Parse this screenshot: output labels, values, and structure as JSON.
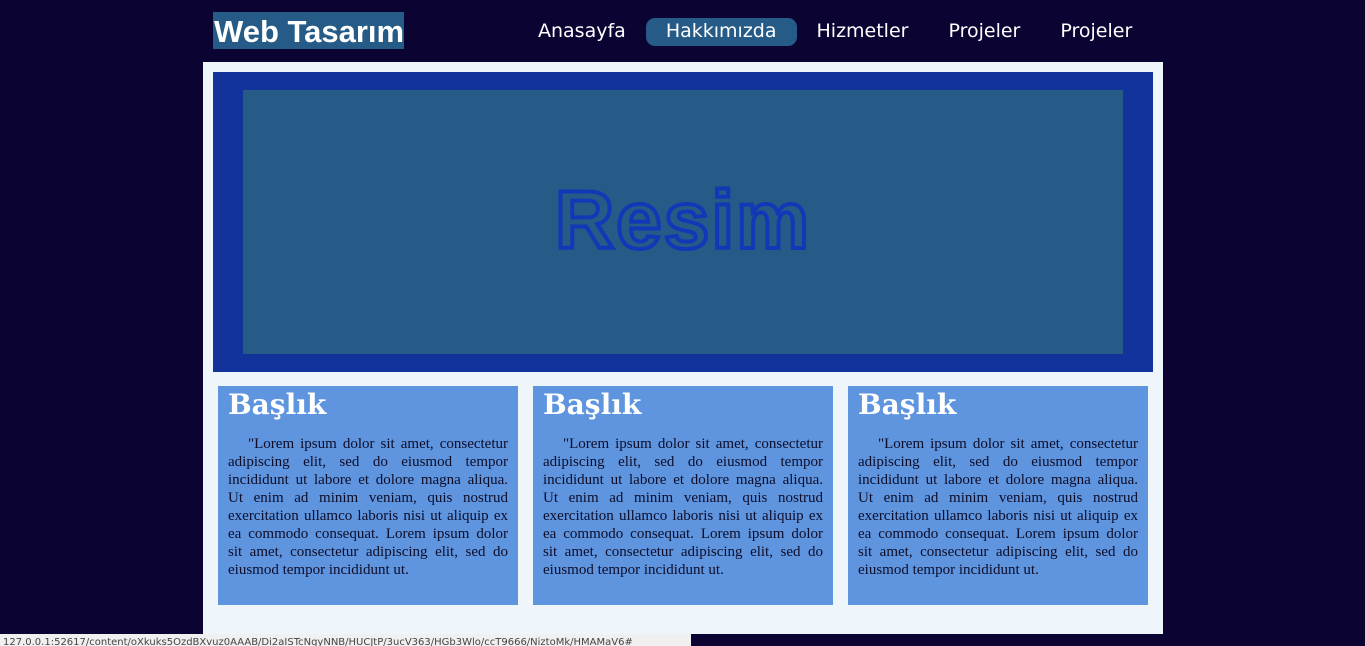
{
  "header": {
    "logo_text": "Web Tasarım"
  },
  "nav": {
    "items": [
      {
        "label": "Anasayfa",
        "active": false
      },
      {
        "label": "Hakkımızda",
        "active": true
      },
      {
        "label": "Hizmetler",
        "active": false
      },
      {
        "label": "Projeler",
        "active": false
      },
      {
        "label": "Projeler",
        "active": false
      }
    ]
  },
  "banner": {
    "image_text": "Resim"
  },
  "cards": [
    {
      "title": "Başlık",
      "body": "\"Lorem ipsum dolor sit amet, consectetur adipiscing elit, sed do eiusmod tempor incididunt ut labore et dolore magna aliqua. Ut enim ad minim veniam, quis nostrud exercitation ullamco laboris nisi ut aliquip ex ea commodo consequat. Lorem ipsum dolor sit amet, consectetur adipiscing elit, sed do eiusmod tempor incididunt ut."
    },
    {
      "title": "Başlık",
      "body": "\"Lorem ipsum dolor sit amet, consectetur adipiscing elit, sed do eiusmod tempor incididunt ut labore et dolore magna aliqua. Ut enim ad minim veniam, quis nostrud exercitation ullamco laboris nisi ut aliquip ex ea commodo consequat. Lorem ipsum dolor sit amet, consectetur adipiscing elit, sed do eiusmod tempor incididunt ut."
    },
    {
      "title": "Başlık",
      "body": "\"Lorem ipsum dolor sit amet, consectetur adipiscing elit, sed do eiusmod tempor incididunt ut labore et dolore magna aliqua. Ut enim ad minim veniam, quis nostrud exercitation ullamco laboris nisi ut aliquip ex ea commodo consequat. Lorem ipsum dolor sit amet, consectetur adipiscing elit, sed do eiusmod tempor incididunt ut."
    }
  ],
  "status_bar": {
    "url": "127.0.0.1:52617/content/oXkuks5OzdBXvuz0AAAB/Di2aISTcNgyNNB/HUCJtP/3ucV363/HGb3Wlo/ccT9666/NiztoMk/HMAMaV6#"
  },
  "colors": {
    "page_background": "#0b0332",
    "logo_background": "#265a87",
    "nav_active_background": "#265a87",
    "container_background": "#eef6fc",
    "banner_frame": "#12339b",
    "banner_image": "#265a87",
    "banner_text": "#1238b8",
    "card_background": "#5e95de"
  }
}
